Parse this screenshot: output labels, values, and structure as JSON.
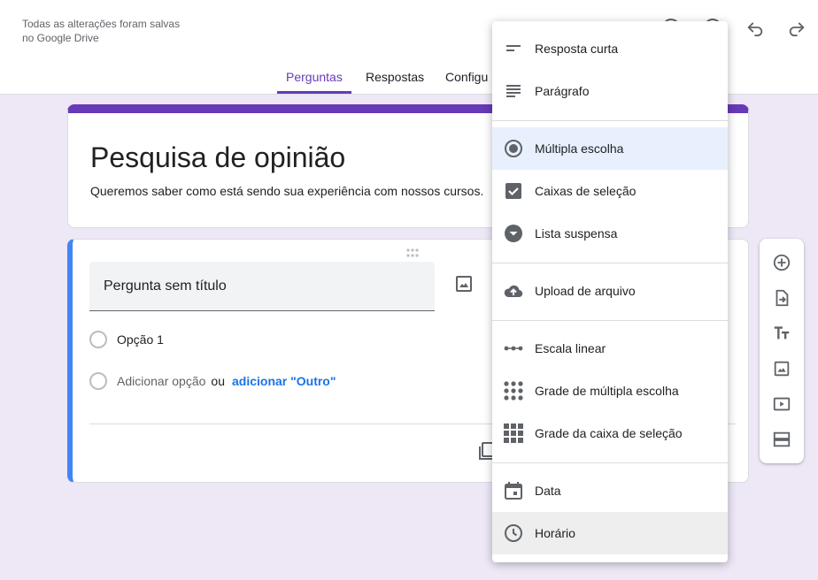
{
  "header": {
    "save_status": "Todas as alterações foram salvas no Google Drive",
    "icons": [
      "palette-icon",
      "preview-icon",
      "undo-icon",
      "redo-icon"
    ]
  },
  "tabs": [
    {
      "label": "Perguntas",
      "active": true
    },
    {
      "label": "Respostas",
      "active": false
    },
    {
      "label": "Configu",
      "active": false
    }
  ],
  "form": {
    "title": "Pesquisa de opinião",
    "description": "Queremos saber como está sendo sua experiência com nossos cursos."
  },
  "question": {
    "title": "Pergunta sem título",
    "option1": "Opção 1",
    "add_option": "Adicionar opção",
    "or": "ou",
    "add_other": "adicionar \"Outro\""
  },
  "question_type_menu": {
    "items": [
      {
        "label": "Resposta curta",
        "icon": "short-answer-icon"
      },
      {
        "label": "Parágrafo",
        "icon": "paragraph-icon"
      },
      {
        "label": "Múltipla escolha",
        "icon": "radio-button-icon",
        "selected": true
      },
      {
        "label": "Caixas de seleção",
        "icon": "checkbox-icon"
      },
      {
        "label": "Lista suspensa",
        "icon": "dropdown-icon"
      },
      {
        "label": "Upload de arquivo",
        "icon": "cloud-upload-icon"
      },
      {
        "label": "Escala linear",
        "icon": "linear-scale-icon"
      },
      {
        "label": "Grade de múltipla escolha",
        "icon": "grid-dots-icon"
      },
      {
        "label": "Grade da caixa de seleção",
        "icon": "grid-squares-icon"
      },
      {
        "label": "Data",
        "icon": "calendar-icon"
      },
      {
        "label": "Horário",
        "icon": "clock-icon",
        "hovered": true
      }
    ]
  },
  "side_toolbar": {
    "icons": [
      "add-question-icon",
      "import-questions-icon",
      "add-title-icon",
      "add-image-icon",
      "add-video-icon",
      "add-section-icon"
    ]
  },
  "colors": {
    "accent": "#673ab7",
    "question_border": "#4285f4",
    "link": "#1a73e8",
    "background": "#ede7f6",
    "selected_item": "#e8f0fe"
  }
}
